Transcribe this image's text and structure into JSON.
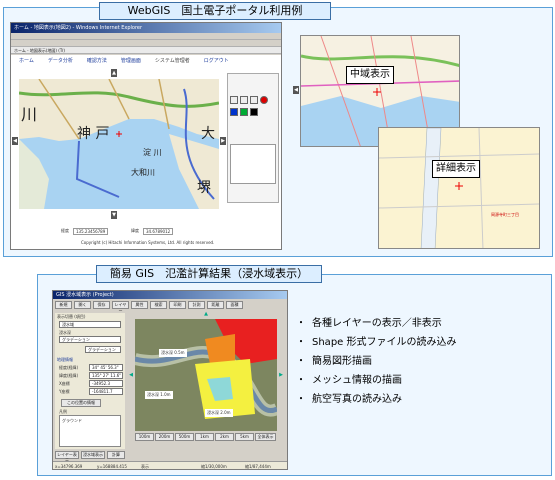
{
  "top_section": {
    "title": "WebGIS　国土電子ポータル利用例",
    "browser": {
      "window_title": "ホーム - 地図表示(地図2) - Windows Internet Explorer",
      "tab_label": "ホーム - 地図表示(地図) (Tr)",
      "nav_links": [
        "ホーム",
        "データ分析",
        "確認方法",
        "管理画面",
        "システム管理者",
        "ログアウト"
      ],
      "map_labels": {
        "big_river": "川",
        "kobe": "神 戸",
        "osaka": "大",
        "sakai": "堺",
        "yodogawa": "淀 川",
        "yamatogawa": "大和川"
      },
      "coord_label_x": "経度",
      "coord_value_x": "135.23456789",
      "coord_label_y": "緯度",
      "coord_value_y": "34.6789012",
      "copyright": "Copyright (c) Hitachi Information Systems, Ltd. All rights reserved."
    },
    "callout_mid": "中域表示",
    "callout_detail": "詳細表示",
    "detail_place_label": "岡源寺町三丁目"
  },
  "bottom_section": {
    "title": "簡易 GIS　氾濫計算結果（浸水域表示）",
    "app": {
      "window_title": "GIS 浸水域表示 (Project)",
      "toolbar": [
        "新規",
        "開く",
        "保存",
        "レイヤー",
        "属性",
        "検索",
        "印刷",
        "計測",
        "距離",
        "面積"
      ],
      "left_panel": {
        "group1_label": "表示切替 (項目)",
        "select1": "浸水域",
        "select2_label": "浸水深",
        "select2": "グラデーション",
        "select3": "グラデーション",
        "group2_label": "地理情報",
        "fields": [
          {
            "label": "経度(経緯)",
            "value": "34° 45' 56.3\""
          },
          {
            "label": "緯度(経緯)",
            "value": "135° 27' 11.6\""
          },
          {
            "label": "X座標",
            "value": "-34952.3"
          },
          {
            "label": "Y座標",
            "value": "-164811.7"
          }
        ],
        "info_button": "この位置の情報",
        "list_label": "凡例",
        "list_item": "グラウンド"
      },
      "bottom_buttons": [
        "レイヤー表示",
        "浸水域表示",
        "計算"
      ],
      "scale_buttons": [
        "100m",
        "200m",
        "500m",
        "1km",
        "2km",
        "5km",
        "全体表示"
      ],
      "status": [
        "x=34796.369",
        "y=168884.415",
        "表示",
        "縮1/30,000m",
        "縮1/87,444m"
      ],
      "map_tags": [
        "浸水深 0.5m",
        "浸水深 1.0m",
        "浸水深 2.0m"
      ]
    },
    "features": [
      "各種レイヤーの表示／非表示",
      "Shape 形式ファイルの読み込み",
      "簡易図形描画",
      "メッシュ情報の描画",
      "航空写真の読み込み"
    ],
    "bullet_symbol": "・"
  },
  "colors": {
    "panel_border": "#5aa0d8",
    "panel_bg": "#eef7ff",
    "water": "#a9d3f2",
    "land": "#efe9d4",
    "flood_red": "#e82020",
    "flood_yellow": "#f4f040"
  }
}
